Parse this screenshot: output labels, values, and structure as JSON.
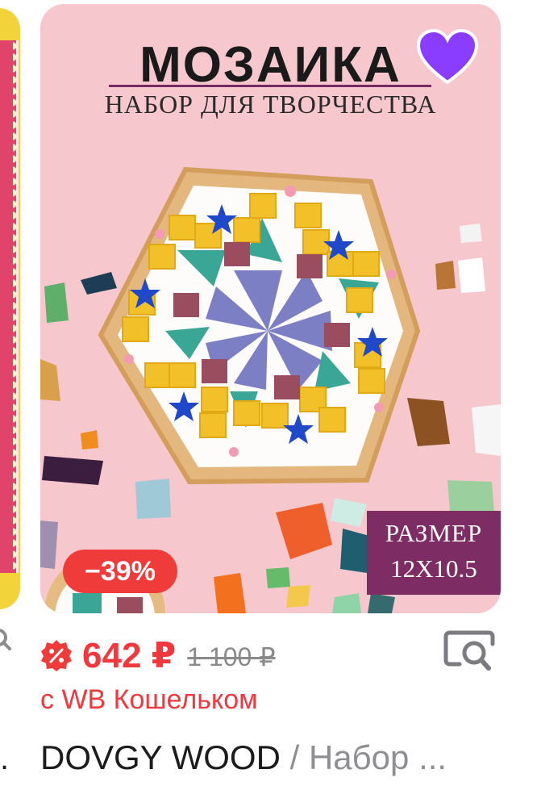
{
  "product": {
    "banner_title": "МОЗАИКА",
    "banner_subtitle": "НАБОР ДЛЯ ТВОРЧЕСТВА",
    "size_label": "РАЗМЕР",
    "size_value": "12X10.5",
    "discount": "−39%",
    "price_current": "642 ₽",
    "price_old": "1 100 ₽",
    "wallet_note": "с WB Кошельком",
    "brand": "DOVGY WOOD",
    "separator": "/",
    "name": "Набор ..."
  },
  "previous_card": {
    "title_tail": "."
  },
  "colors": {
    "accent_red": "#f03b3b",
    "favorite_purple": "#8b3dff",
    "card_background": "#f6c8cd",
    "size_tag": "#7d2d64"
  },
  "icons": {
    "favorite": "heart-icon",
    "wallet": "wallet-discount-icon",
    "similar": "image-search-icon"
  }
}
